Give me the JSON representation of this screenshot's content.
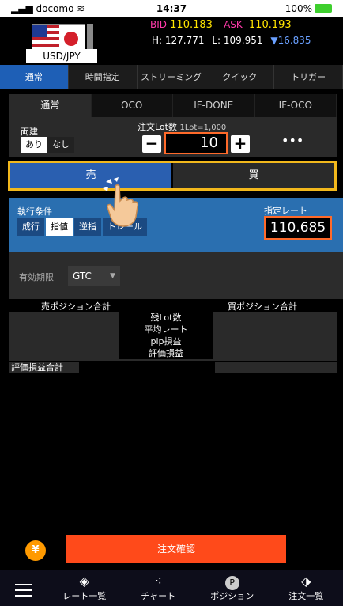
{
  "status": {
    "carrier": "docomo",
    "time": "14:37",
    "battery": "100%"
  },
  "header": {
    "pair": "USD/JPY",
    "bid_label": "BID",
    "bid": "110.183",
    "ask_label": "ASK",
    "ask": "110.193",
    "high": "H: 127.771",
    "low": "L: 109.951",
    "change": "▼16.835"
  },
  "main_tabs": [
    "通常",
    "時間指定",
    "ストリーミング",
    "クイック",
    "トリガー"
  ],
  "sub_tabs": [
    "通常",
    "OCO",
    "IF-DONE",
    "IF-OCO"
  ],
  "hedge": {
    "label": "両建",
    "on": "あり",
    "off": "なし"
  },
  "lot": {
    "label": "注文Lot数",
    "sub": "1Lot=1,000",
    "value": "10",
    "more": "•••"
  },
  "side": {
    "sell": "売",
    "buy": "買"
  },
  "execution": {
    "label": "執行条件",
    "options": [
      "成行",
      "指値",
      "逆指",
      "トレール"
    ],
    "rate_label": "指定レート",
    "rate_value": "110.685"
  },
  "expiry": {
    "label": "有効期限",
    "value": "GTC"
  },
  "positions": {
    "sell_total": "売ポジション合計",
    "buy_total": "買ポジション合計",
    "rows": [
      "残Lot数",
      "平均レート",
      "pip損益",
      "評価損益"
    ],
    "eval_total": "評価損益合計"
  },
  "actions": {
    "yen": "¥",
    "confirm": "注文確認"
  },
  "bottom_nav": [
    "レート一覧",
    "チャート",
    "ポジション",
    "注文一覧"
  ]
}
